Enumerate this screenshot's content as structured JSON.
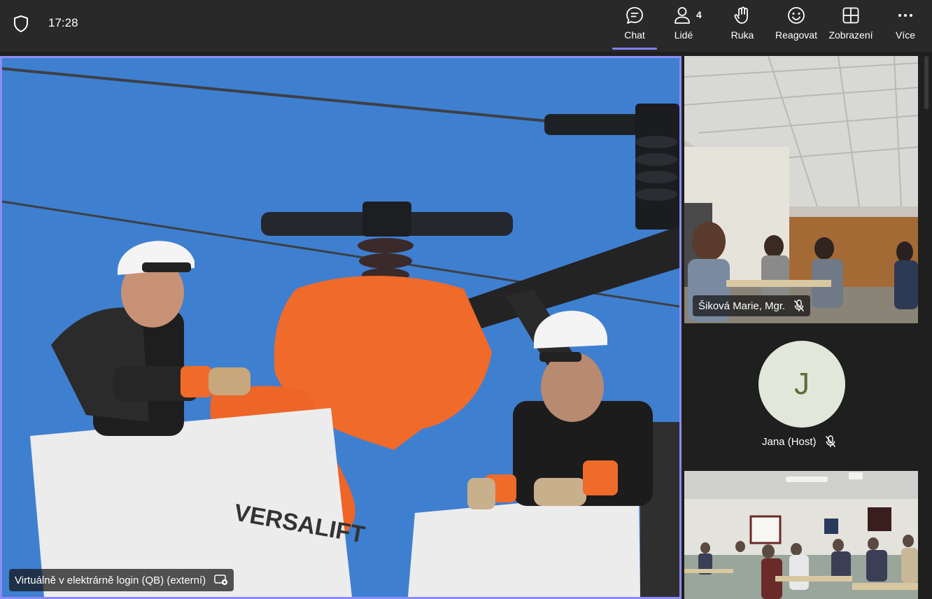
{
  "header": {
    "time": "17:28",
    "people_count": "4",
    "buttons": {
      "chat": "Chat",
      "people": "Lidé",
      "raise_hand": "Ruka",
      "react": "Reagovat",
      "view": "Zobrazení",
      "more": "Více"
    }
  },
  "main_video": {
    "participant_name": "Virtuálně v elektrárně login (QB) (externí)",
    "bucket_text": "VERSALIFT"
  },
  "sidebar": {
    "participants": [
      {
        "name": "Šiková Marie, Mgr.",
        "muted": true
      },
      {
        "name": "Jana (Host)",
        "initial": "J",
        "muted": true
      }
    ]
  },
  "colors": {
    "accent": "#7f85f5",
    "topbar": "#292929",
    "background": "#1f1f1f",
    "avatar_bg": "#e1e8d9",
    "avatar_fg": "#5d6e39"
  }
}
